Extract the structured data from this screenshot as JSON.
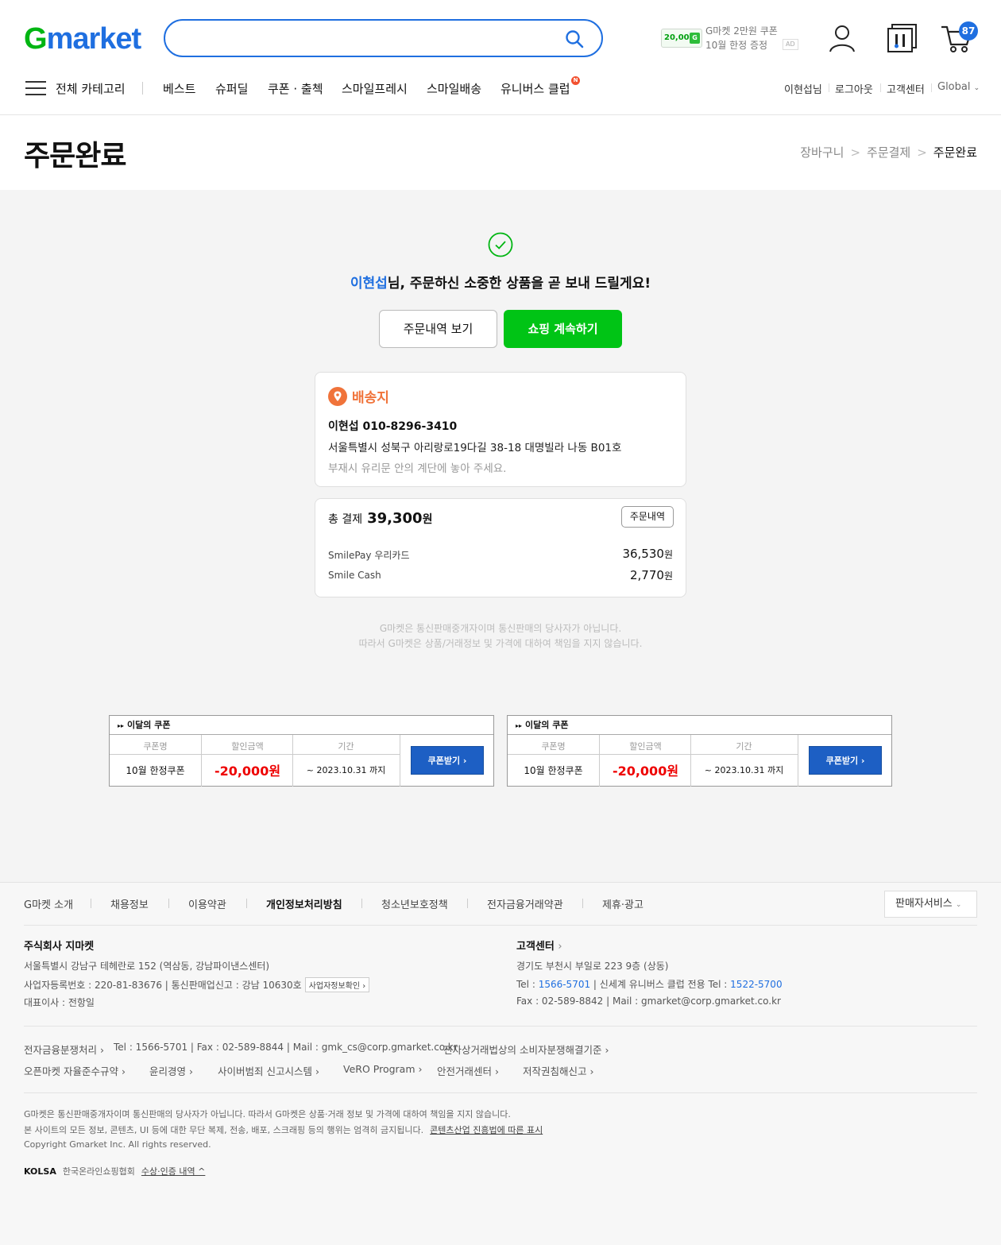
{
  "header": {
    "logo_g": "G",
    "logo_rest": "market",
    "search": {
      "placeholder": ""
    },
    "ad": {
      "coupon_value": "20,000",
      "coupon_mark": "G",
      "line1": "G마켓 2만원 쿠폰",
      "line2": "10월 한정 증정",
      "tag": "AD"
    },
    "cart_count": "87",
    "menu_label": "전체 카테고리",
    "nav": [
      "베스트",
      "슈퍼딜",
      "쿠폰 · 출첵",
      "스마일프레시",
      "스마일배송",
      "유니버스 클럽"
    ],
    "nav_new_badge": "N",
    "util": [
      "이현섭님",
      "로그아웃",
      "고객센터",
      "Global"
    ]
  },
  "titlebar": {
    "title": "주문완료",
    "breadcrumbs": [
      "장바구니",
      "주문결제",
      "주문완료"
    ]
  },
  "confirmation": {
    "user_name": "이현섭",
    "message": "님, 주문하신 소중한 상품을 곧 보내 드릴게요!",
    "orders_button": "주문내역 보기",
    "shop_button": "쇼핑 계속하기"
  },
  "address": {
    "title": "배송지",
    "name_phone": "이현섭  010-8296-3410",
    "line": "서울특별시 성북구 아리랑로19다길 38-18 대명빌라 나동 B01호",
    "memo": "부재시 유리문 안의 계단에 놓아 주세요."
  },
  "payment": {
    "label": "총 결제",
    "total": "39,300",
    "unit": "원",
    "detail_button": "주문내역",
    "rows": [
      {
        "method": "SmilePay 우리카드",
        "amount": "36,530",
        "unit": "원"
      },
      {
        "method": "Smile Cash",
        "amount": "2,770",
        "unit": "원"
      }
    ]
  },
  "notice": {
    "line1": "G마켓은 통신판매중개자이며 통신판매의 당사자가 아닙니다.",
    "line2": "따라서 G마켓은 상품/거래정보 및 가격에 대하여 책임을 지지 않습니다."
  },
  "coupons": [
    {
      "head": "이달의 쿠폰",
      "col_name": "쿠폰명",
      "col_disc": "할인금액",
      "col_period": "기간",
      "name": "10월 한정쿠폰",
      "discount": "-20,000원",
      "period": "~ 2023.10.31 까지",
      "button": "쿠폰받기 ›"
    },
    {
      "head": "이달의 쿠폰",
      "col_name": "쿠폰명",
      "col_disc": "할인금액",
      "col_period": "기간",
      "name": "10월 한정쿠폰",
      "discount": "-20,000원",
      "period": "~ 2023.10.31 까지",
      "button": "쿠폰받기 ›"
    }
  ],
  "footer": {
    "links": [
      "G마켓 소개",
      "채용정보",
      "이용약관",
      "개인정보처리방침",
      "청소년보호정책",
      "전자금융거래약관",
      "제휴·광고"
    ],
    "seller_service": "판매자서비스",
    "company": {
      "title": "주식회사 지마켓",
      "address": "서울특별시 강남구 테헤란로 152 (역삼동, 강남파이낸스센터)",
      "reg": "사업자등록번호 : 220-81-83676 | 통신판매업신고 : 강남 10630호",
      "reg_button": "사업자정보확인 ›",
      "ceo": "대표이사 : 전항일"
    },
    "cs": {
      "title": "고객센터",
      "address": "경기도 부천시 부일로 223 9층 (상동)",
      "tel_label": "Tel : ",
      "tel": "1566-5701",
      "universe_label": " | 신세계 유니버스 클럽 전용 Tel : ",
      "universe_tel": "1522-5700",
      "fax": "Fax : 02-589-8842 | Mail : gmarket@corp.gmarket.co.kr"
    },
    "dispute": {
      "label": "전자금융분쟁처리 ›",
      "contact": "Tel : 1566-5701 | Fax : 02-589-8844 | Mail : gmk_cs@corp.gmarket.co.kr",
      "consumer": "전자상거래법상의 소비자분쟁해결기준 ›"
    },
    "links2": [
      "오픈마켓 자율준수규약 ›",
      "윤리경영 ›",
      "사이버범죄 신고시스템 ›",
      "VeRO Program ›",
      "안전거래센터 ›",
      "저작권침해신고 ›"
    ],
    "disclaimer1": "G마켓은 통신판매중개자이며 통신판매의 당사자가 아닙니다. 따라서 G마켓은 상품·거래 정보 및 가격에 대하여 책임을 지지 않습니다.",
    "disclaimer2": "본 사이트의 모든 정보, 콘텐츠, UI 등에 대한 무단 복제, 전송, 배포, 스크래핑 등의 행위는 엄격히 금지됩니다.",
    "content_law": "콘텐츠산업 진흥법에 따른 표시",
    "copyright": "Copyright Gmarket Inc. All rights reserved.",
    "kolsa_logo": "KOLSA",
    "kolsa_name": "한국온라인쇼핑협회",
    "awards": "수상·인증 내역 ^"
  }
}
